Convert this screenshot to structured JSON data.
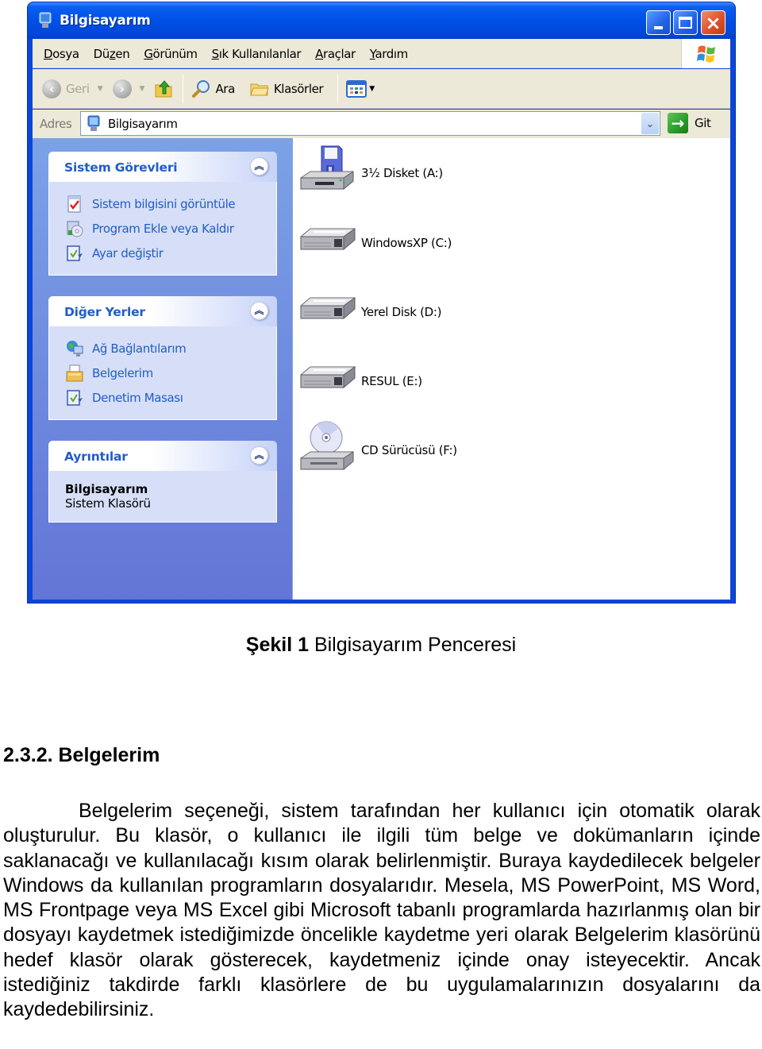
{
  "window": {
    "title": "Bilgisayarım",
    "controls": {
      "minimize": "minimize",
      "maximize": "maximize",
      "close": "×"
    }
  },
  "menubar": {
    "items": [
      {
        "label": "Dosya",
        "accel": "D"
      },
      {
        "label": "Düzen",
        "accel": "z"
      },
      {
        "label": "Görünüm",
        "accel": "G"
      },
      {
        "label": "Sık Kullanılanlar",
        "accel": "S"
      },
      {
        "label": "Araçlar",
        "accel": "A"
      },
      {
        "label": "Yardım",
        "accel": "Y"
      }
    ]
  },
  "toolbar": {
    "back_label": "Geri",
    "forward_label": "",
    "search_label": "Ara",
    "folders_label": "Klasörler"
  },
  "addressbar": {
    "label": "Adres",
    "value": "Bilgisayarım",
    "go_label": "Git"
  },
  "sidebar": {
    "system_tasks": {
      "title": "Sistem Görevleri",
      "items": [
        {
          "label": "Sistem bilgisini görüntüle",
          "icon": "system-info-icon"
        },
        {
          "label": "Program Ekle veya Kaldır",
          "icon": "add-remove-programs-icon"
        },
        {
          "label": "Ayar değiştir",
          "icon": "control-panel-icon"
        }
      ]
    },
    "other_places": {
      "title": "Diğer Yerler",
      "items": [
        {
          "label": "Ağ Bağlantılarım",
          "icon": "network-places-icon"
        },
        {
          "label": "Belgelerim",
          "icon": "my-documents-icon"
        },
        {
          "label": "Denetim Masası",
          "icon": "control-panel-icon"
        }
      ]
    },
    "details": {
      "title": "Ayrıntılar",
      "name": "Bilgisayarım",
      "type": "Sistem Klasörü"
    }
  },
  "drives": [
    {
      "label": "3½ Disket (A:)",
      "icon": "floppy-drive-icon"
    },
    {
      "label": "WindowsXP (C:)",
      "icon": "hard-drive-icon"
    },
    {
      "label": "Yerel Disk (D:)",
      "icon": "hard-drive-icon"
    },
    {
      "label": "RESUL (E:)",
      "icon": "hard-drive-icon"
    },
    {
      "label": "CD Sürücüsü (F:)",
      "icon": "cd-drive-icon"
    }
  ],
  "document": {
    "caption_bold": "Şekil 1",
    "caption_text": " Bilgisayarım Penceresi",
    "section_heading": "2.3.2. Belgelerim",
    "paragraph": "Belgelerim seçeneği, sistem tarafından her kullanıcı için otomatik olarak oluşturulur. Bu klasör, o kullanıcı ile ilgili tüm belge ve dokümanların içinde saklanacağı ve kullanılacağı kısım olarak belirlenmiştir. Buraya kaydedilecek belgeler Windows da kullanılan programların dosyalarıdır. Mesela, MS PowerPoint, MS Word, MS Frontpage veya MS Excel gibi Microsoft tabanlı programlarda hazırlanmış olan bir dosyayı kaydetmek istediğimizde öncelikle kaydetme yeri olarak Belgelerim klasörünü hedef klasör olarak gösterecek, kaydetmeniz içinde onay isteyecektir. Ancak istediğiniz takdirde farklı klasörlere de bu uygulamalarınızın dosyalarını da kaydedebilirsiniz."
  }
}
